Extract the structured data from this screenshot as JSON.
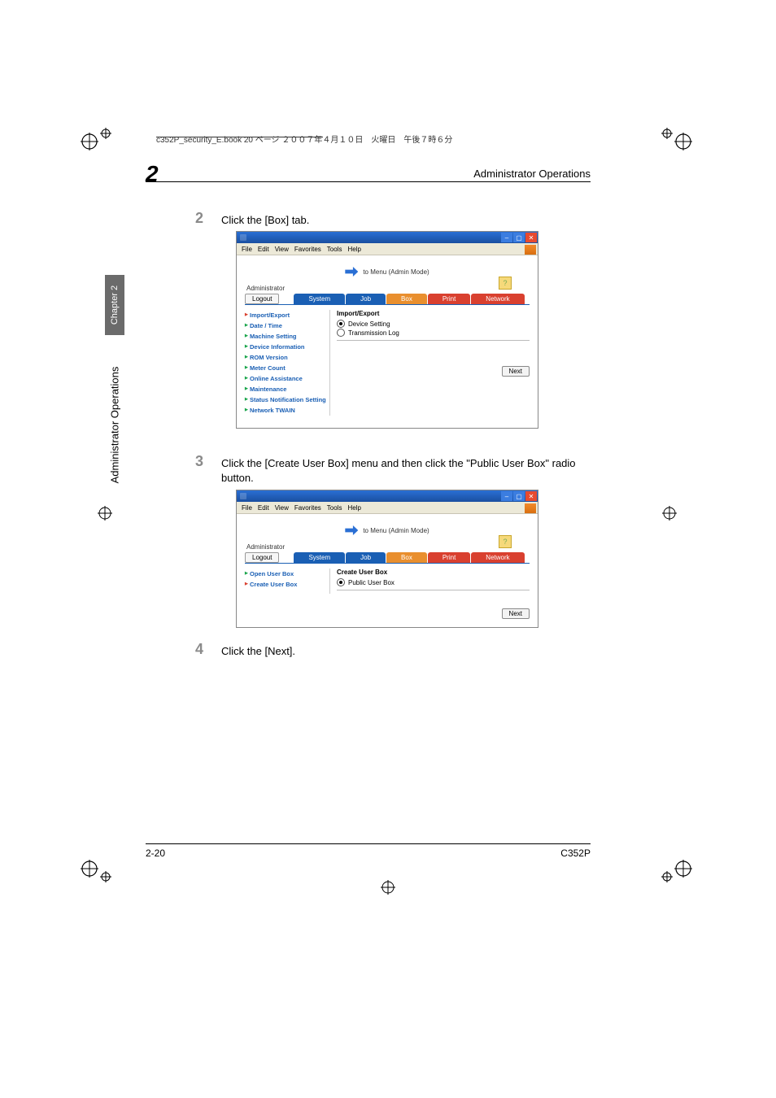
{
  "header_line": "c352P_security_E.book  20 ページ  ２００７年４月１０日　火曜日　午後７時６分",
  "section_title": "Administrator Operations",
  "chapter_big": "2",
  "sidebar_tab": "Chapter 2",
  "sidebar_text": "Administrator Operations",
  "steps": {
    "s2": {
      "num": "2",
      "text": "Click the [Box] tab."
    },
    "s3": {
      "num": "3",
      "text": "Click the [Create User Box] menu and then click the \"Public User Box\" radio button."
    },
    "s4": {
      "num": "4",
      "text": "Click the [Next]."
    }
  },
  "screenshot_common": {
    "menu": {
      "file": "File",
      "edit": "Edit",
      "view": "View",
      "favorites": "Favorites",
      "tools": "Tools",
      "help": "Help"
    },
    "mode": "to Menu (Admin Mode)",
    "administrator": "Administrator",
    "logout": "Logout",
    "help_glyph": "?",
    "tabs": {
      "system": "System",
      "job": "Job",
      "box": "Box",
      "print": "Print",
      "network": "Network"
    },
    "next": "Next"
  },
  "screenshot1": {
    "sidebar": [
      "Import/Export",
      "Date / Time",
      "Machine Setting",
      "Device Information",
      "ROM Version",
      "Meter Count",
      "Online Assistance",
      "Maintenance",
      "Status Notification Setting",
      "Network TWAIN"
    ],
    "pane_title": "Import/Export",
    "radio1": "Device Setting",
    "radio2": "Transmission Log",
    "active_tab": "system"
  },
  "screenshot2": {
    "sidebar": [
      "Open User Box",
      "Create User Box"
    ],
    "pane_title": "Create User Box",
    "radio1": "Public User Box",
    "active_tab": "box"
  },
  "footer": {
    "left": "2-20",
    "right": "C352P"
  }
}
